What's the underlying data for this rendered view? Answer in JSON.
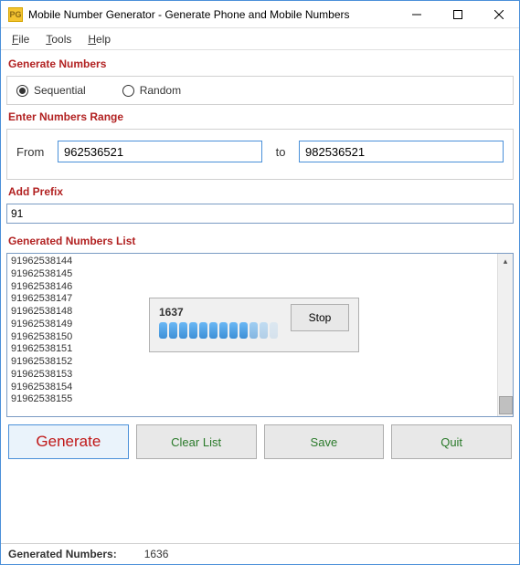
{
  "window": {
    "title": "Mobile Number Generator - Generate Phone and Mobile Numbers",
    "icon_text": "PG"
  },
  "menu": {
    "file": "File",
    "tools": "Tools",
    "help": "Help"
  },
  "sections": {
    "generate_numbers": "Generate Numbers",
    "enter_range": "Enter Numbers Range",
    "add_prefix": "Add Prefix",
    "generated_list": "Generated Numbers List"
  },
  "mode": {
    "sequential": "Sequential",
    "random": "Random",
    "selected": "sequential"
  },
  "range": {
    "from_label": "From",
    "from_value": "962536521",
    "to_label": "to",
    "to_value": "982536521"
  },
  "prefix": {
    "value": "91"
  },
  "generated_numbers": [
    "91962538144",
    "91962538145",
    "91962538146",
    "91962538147",
    "91962538148",
    "91962538149",
    "91962538150",
    "91962538151",
    "91962538152",
    "91962538153",
    "91962538154",
    "91962538155"
  ],
  "progress": {
    "count": "1637",
    "stop_label": "Stop"
  },
  "buttons": {
    "generate": "Generate",
    "clear": "Clear List",
    "save": "Save",
    "quit": "Quit"
  },
  "status": {
    "label": "Generated Numbers:",
    "value": "1636"
  }
}
